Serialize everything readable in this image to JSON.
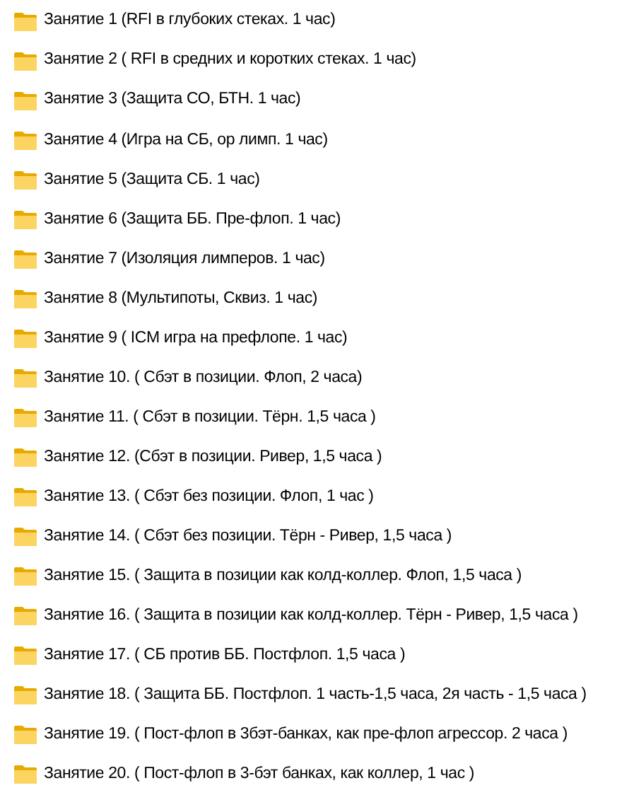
{
  "folders": [
    {
      "name": "Занятие 1 (RFI в глубоких стеках. 1 час)"
    },
    {
      "name": "Занятие 2 ( RFI в средних и коротких стеках. 1 час)"
    },
    {
      "name": "Занятие 3 (Защита СО, БТН. 1 час)"
    },
    {
      "name": "Занятие 4 (Игра на СБ, ор лимп. 1 час)"
    },
    {
      "name": "Занятие 5 (Защита СБ. 1 час)"
    },
    {
      "name": "Занятие 6 (Защита ББ. Пре-флоп. 1 час)"
    },
    {
      "name": "Занятие 7 (Изоляция лимперов. 1 час)"
    },
    {
      "name": "Занятие 8 (Мультипоты, Сквиз. 1 час)"
    },
    {
      "name": "Занятие 9 ( ICM игра на префлопе. 1 час)"
    },
    {
      "name": "Занятие 10. ( Сбэт в позиции. Флоп, 2 часа)"
    },
    {
      "name": "Занятие 11. ( Сбэт в позиции. Тёрн. 1,5 часа )"
    },
    {
      "name": "Занятие 12. (Сбэт в позиции. Ривер, 1,5 часа )"
    },
    {
      "name": "Занятие 13. ( Сбэт без позиции. Флоп, 1 час )"
    },
    {
      "name": "Занятие 14. ( Сбэт без позиции. Тёрн - Ривер, 1,5 часа )"
    },
    {
      "name": "Занятие 15. ( Защита в позиции как колд-коллер. Флоп, 1,5 часа )"
    },
    {
      "name": "Занятие 16. ( Защита в позиции как колд-коллер. Тёрн - Ривер, 1,5 часа )"
    },
    {
      "name": "Занятие 17. ( СБ против ББ. Постфлоп. 1,5 часа )"
    },
    {
      "name": "Занятие 18. ( Защита ББ. Постфлоп. 1 часть-1,5 часа, 2я часть - 1,5 часа )"
    },
    {
      "name": "Занятие 19. ( Пост-флоп в 3бэт-банках, как пре-флоп агрессор. 2 часа )"
    },
    {
      "name": "Занятие 20. ( Пост-флоп в 3-бэт банках, как коллер, 1 час )"
    }
  ]
}
